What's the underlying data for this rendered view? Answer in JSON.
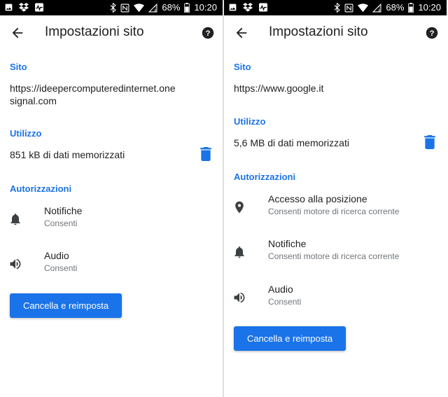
{
  "status_bar": {
    "battery_percent": "68%",
    "time": "10:20"
  },
  "colors": {
    "accent": "#1a73e8",
    "text": "#202124",
    "subtext": "#70757a",
    "icon": "#3c4043"
  },
  "left": {
    "title": "Impostazioni sito",
    "site_header": "Sito",
    "site_url": "https://ideepercomputeredinternet.onesignal.com",
    "usage_header": "Utilizzo",
    "usage_text": "851 kB di dati memorizzati",
    "permissions_header": "Autorizzazioni",
    "permissions": [
      {
        "icon": "bell-icon",
        "title": "Notifiche",
        "status": "Consenti"
      },
      {
        "icon": "speaker-icon",
        "title": "Audio",
        "status": "Consenti"
      }
    ],
    "reset_button": "Cancella e reimposta"
  },
  "right": {
    "title": "Impostazioni sito",
    "site_header": "Sito",
    "site_url": "https://www.google.it",
    "usage_header": "Utilizzo",
    "usage_text": "5,6 MB di dati memorizzati",
    "permissions_header": "Autorizzazioni",
    "permissions": [
      {
        "icon": "location-pin-icon",
        "title": "Accesso alla posizione",
        "status": "Consenti motore di ricerca corrente"
      },
      {
        "icon": "bell-icon",
        "title": "Notifiche",
        "status": "Consenti motore di ricerca corrente"
      },
      {
        "icon": "speaker-icon",
        "title": "Audio",
        "status": "Consenti"
      }
    ],
    "reset_button": "Cancella e reimposta"
  }
}
